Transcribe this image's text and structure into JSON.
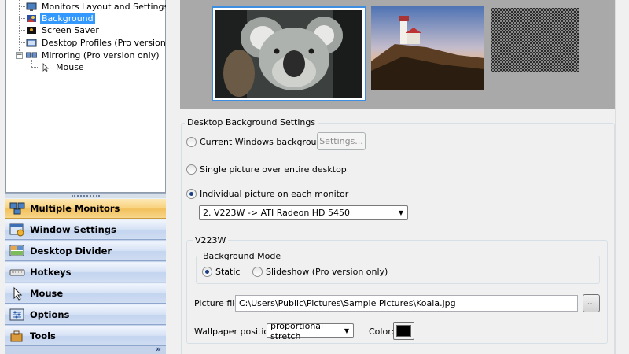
{
  "tree": {
    "items": [
      {
        "label": "Monitors Layout and Settings",
        "icon": "monitor-icon"
      },
      {
        "label": "Background",
        "icon": "background-icon",
        "selected": true
      },
      {
        "label": "Screen Saver",
        "icon": "screensaver-icon"
      },
      {
        "label": "Desktop Profiles (Pro version only)",
        "icon": "profiles-icon"
      },
      {
        "label": "Mirroring (Pro version only)",
        "icon": "mirroring-icon"
      },
      {
        "label": "Mouse",
        "icon": "mouse-icon"
      }
    ]
  },
  "nav": {
    "items": [
      {
        "label": "Multiple Monitors",
        "icon": "multiple-monitors-icon",
        "active": true
      },
      {
        "label": "Window Settings",
        "icon": "window-settings-icon"
      },
      {
        "label": "Desktop Divider",
        "icon": "desktop-divider-icon"
      },
      {
        "label": "Hotkeys",
        "icon": "keyboard-icon"
      },
      {
        "label": "Mouse",
        "icon": "mouse-icon"
      },
      {
        "label": "Options",
        "icon": "options-icon"
      },
      {
        "label": "Tools",
        "icon": "tools-icon"
      }
    ],
    "more": "»"
  },
  "preview": {
    "monitors": [
      {
        "name": "koala-wallpaper",
        "selected": true
      },
      {
        "name": "lighthouse-wallpaper"
      },
      {
        "name": "checkered-wallpaper"
      }
    ]
  },
  "settings": {
    "group_title": "Desktop Background Settings",
    "current_bg_label": "Current Windows background",
    "settings_button": "Settings...",
    "single_picture_label": "Single picture over entire desktop",
    "individual_picture_label": "Individual picture on each monitor",
    "monitor_select": "2. V223W -> ATI Radeon HD 5450",
    "selected_mode": "individual"
  },
  "monitor_group": {
    "title": "V223W",
    "bg_mode_title": "Background Mode",
    "static_label": "Static",
    "slideshow_label": "Slideshow (Pro version only)",
    "selected_mode": "static",
    "picture_file_label": "Picture file:",
    "picture_file_value": "C:\\Users\\Public\\Pictures\\Sample Pictures\\Koala.jpg",
    "browse_label": "...",
    "wallpaper_position_label": "Wallpaper position:",
    "wallpaper_position_value": "proportional stretch",
    "color_label": "Color:",
    "color_value": "#000000"
  },
  "colors": {
    "selection": "#3399ff",
    "nav_active": "#f8d27e",
    "nav_bg": "#c5d3ea"
  }
}
